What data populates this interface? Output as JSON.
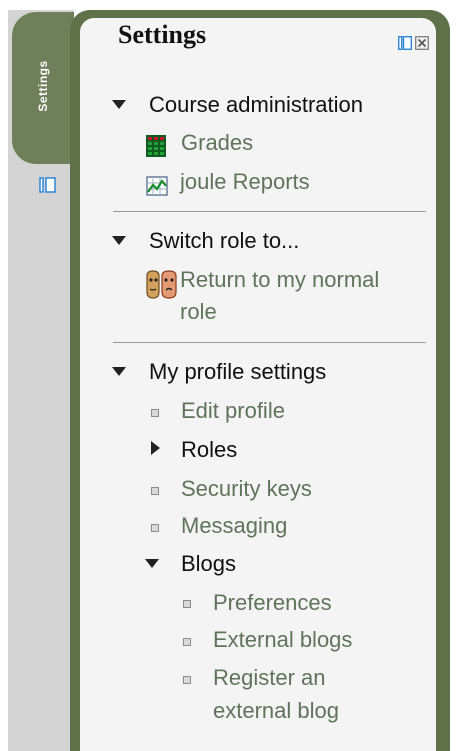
{
  "dock": {
    "tab_label": "Settings"
  },
  "block": {
    "title": "Settings"
  },
  "course_administration": {
    "label": "Course administration",
    "items": [
      {
        "label": "Grades",
        "icon": "grades-icon"
      },
      {
        "label": "joule Reports",
        "icon": "reports-icon"
      }
    ]
  },
  "switch_role": {
    "label": "Switch role to...",
    "items": [
      {
        "label_line1": "Return to my normal",
        "label_line2": "role",
        "icon": "role-icon"
      }
    ]
  },
  "profile": {
    "label": "My profile settings",
    "items": [
      {
        "label": "Edit profile"
      },
      {
        "label": "Roles"
      },
      {
        "label": "Security keys"
      },
      {
        "label": "Messaging"
      },
      {
        "label": "Blogs"
      }
    ],
    "blogs": [
      {
        "label": "Preferences"
      },
      {
        "label": "External blogs"
      },
      {
        "label_line1": "Register an",
        "label_line2": "external blog"
      }
    ]
  },
  "colors": {
    "link": "#5f745a",
    "panel_border": "#5e7149",
    "panel_bg": "#f4f4f4",
    "tab_bg": "#6f7f5a",
    "dock_bg": "#d4d4d4"
  }
}
